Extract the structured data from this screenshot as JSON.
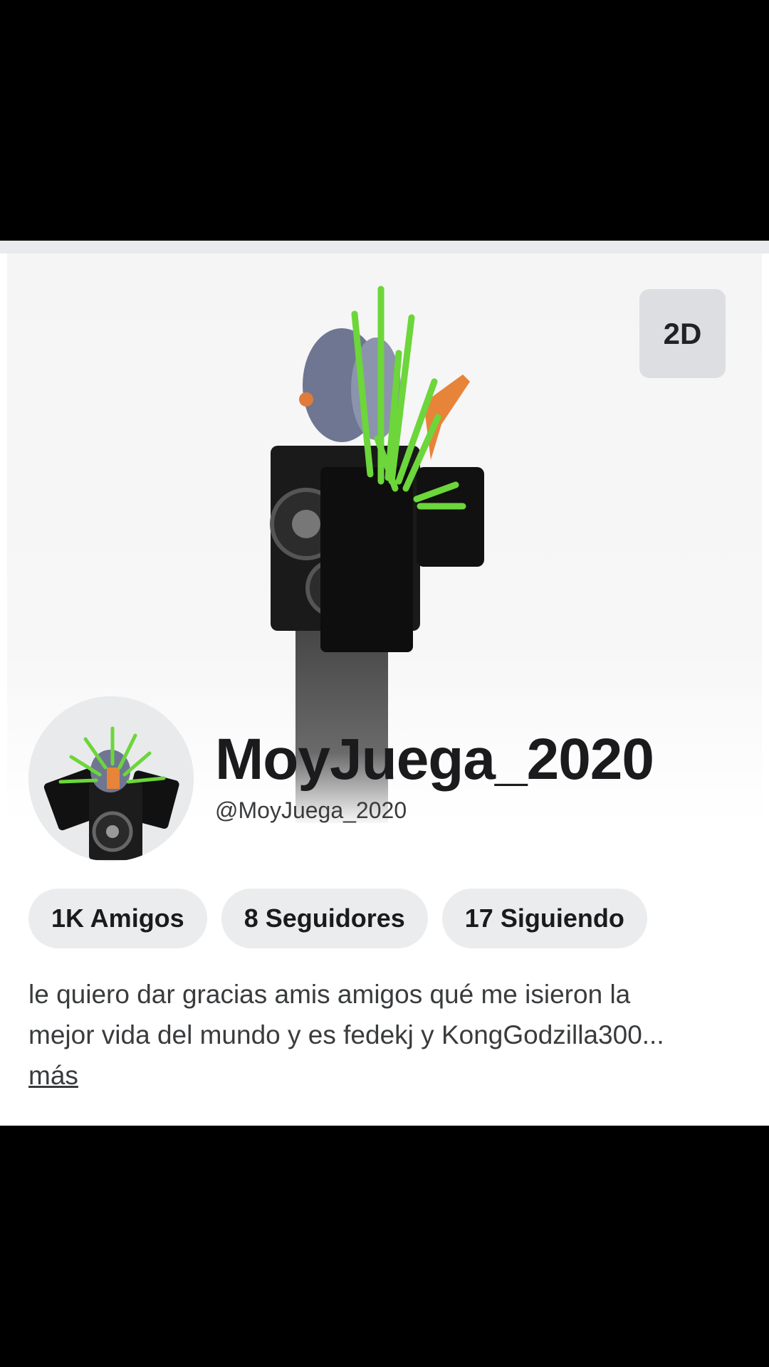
{
  "hero": {
    "toggle_label": "2D"
  },
  "profile": {
    "display_name": "MoyJuega_2020",
    "username": "@MoyJuega_2020"
  },
  "stats": [
    {
      "label": "1K Amigos"
    },
    {
      "label": "8 Seguidores"
    },
    {
      "label": "17 Siguiendo"
    }
  ],
  "bio": {
    "text_line1": "le quiero dar gracias amis amigos qué me isieron la",
    "text_line2": "mejor vida del mundo y es fedekj y KongGodzilla300...",
    "more_label": "más"
  },
  "colors": {
    "background": "#000000",
    "card": "#ffffff",
    "pill": "#ebecee",
    "accent_green": "#6cd63a"
  }
}
